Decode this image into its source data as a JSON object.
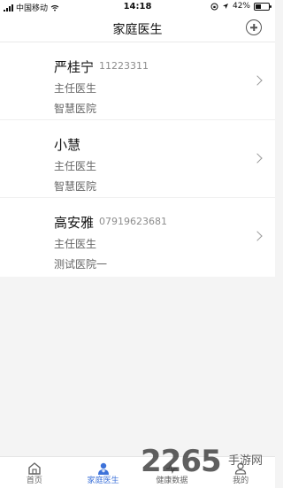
{
  "status_bar": {
    "carrier": "中国移动",
    "time": "14:18",
    "battery": "42%",
    "battery_level": 0.42
  },
  "navbar": {
    "title": "家庭医生"
  },
  "doctors": [
    {
      "name": "严桂宁",
      "phone": "11223311",
      "title": "主任医生",
      "hospital": "智慧医院"
    },
    {
      "name": "小慧",
      "phone": "",
      "title": "主任医生",
      "hospital": "智慧医院"
    },
    {
      "name": "高安雅",
      "phone": "07919623681",
      "title": "主任医生",
      "hospital": "测试医院一"
    }
  ],
  "tabs": [
    {
      "label": "首页",
      "icon": "home-icon"
    },
    {
      "label": "家庭医生",
      "icon": "doctor-icon"
    },
    {
      "label": "健康数据",
      "icon": "health-data-icon"
    },
    {
      "label": "我的",
      "icon": "user-icon"
    }
  ],
  "active_tab": "家庭医生",
  "watermark": {
    "number": "2265",
    "text": "手游网"
  },
  "colors": {
    "accent": "#3d72d9",
    "background": "#f4f4f4"
  }
}
